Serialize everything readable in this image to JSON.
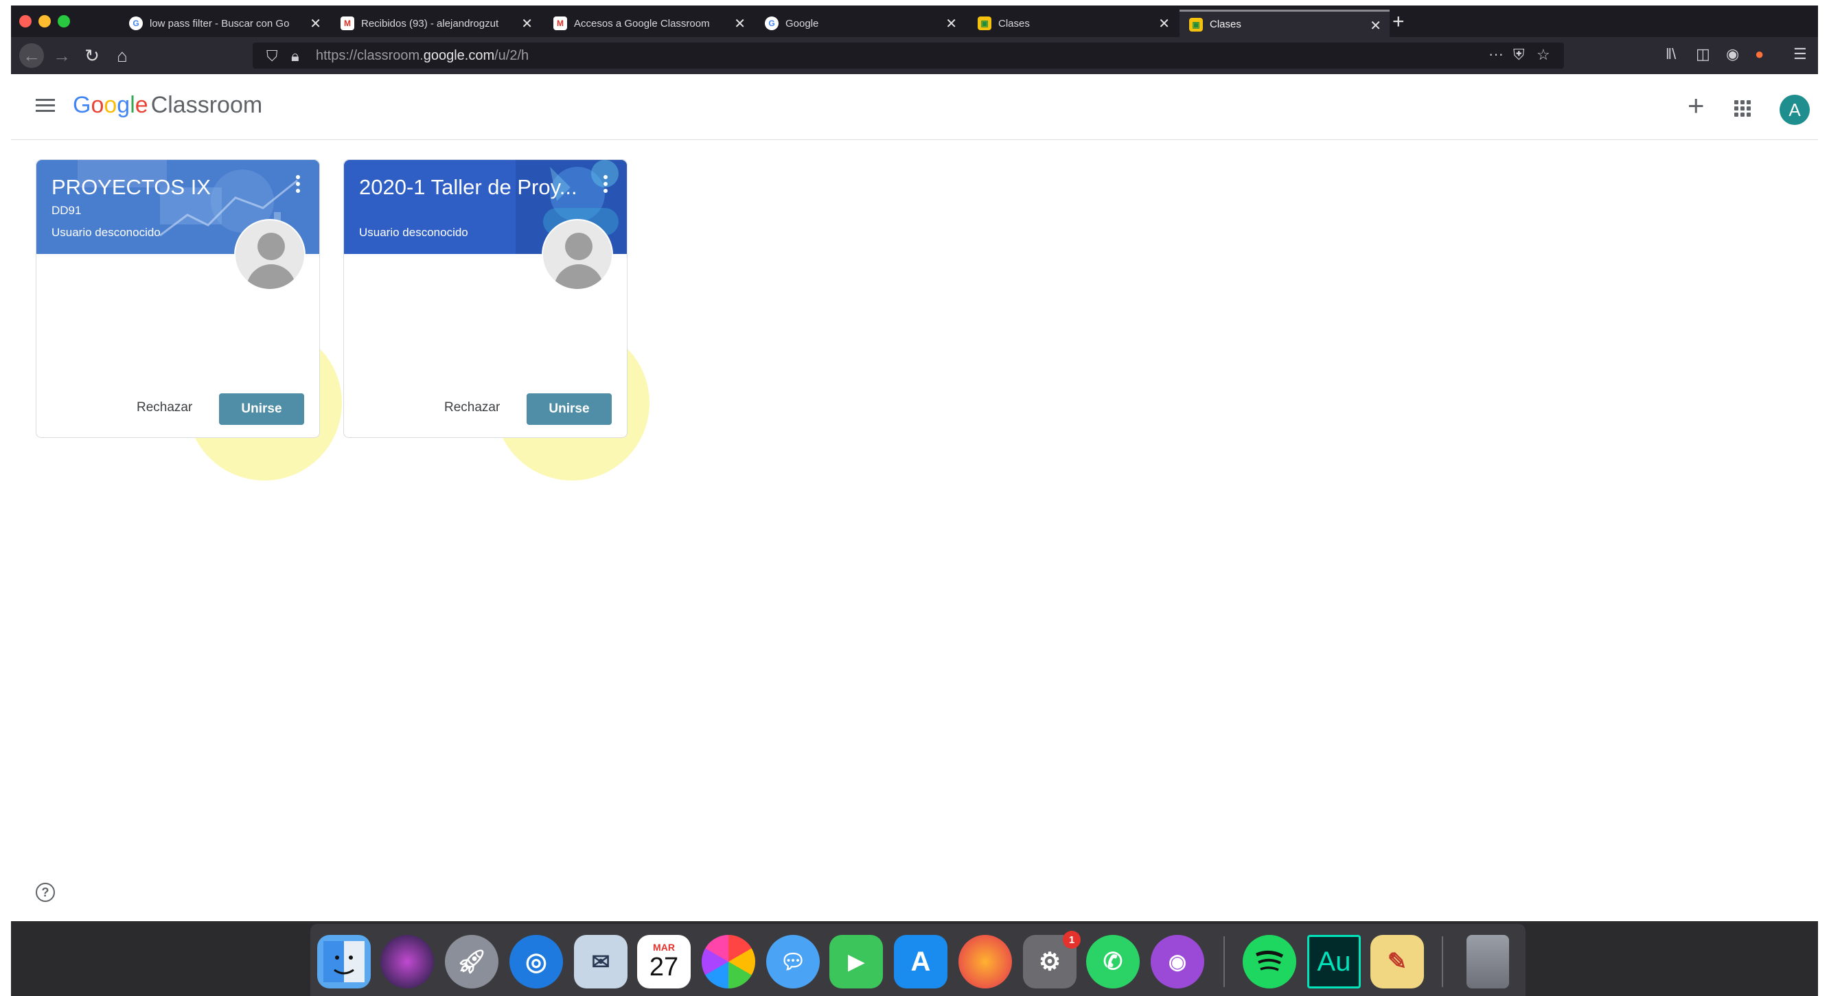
{
  "browser": {
    "tabs": [
      {
        "title": "low pass filter - Buscar con Go",
        "icon": "google-icon"
      },
      {
        "title": "Recibidos (93) - alejandrogzut",
        "icon": "gmail-icon"
      },
      {
        "title": "Accesos a Google Classroom",
        "icon": "gmail-icon"
      },
      {
        "title": "Google",
        "icon": "google-icon"
      },
      {
        "title": "Clases",
        "icon": "classroom-icon"
      },
      {
        "title": "Clases",
        "icon": "classroom-icon"
      }
    ],
    "active_tab_index": 5,
    "url_prefix": "https://classroom.",
    "url_domain": "google.com",
    "url_path": "/u/2/h"
  },
  "header": {
    "logo": {
      "g1": "G",
      "g2": "o",
      "g3": "o",
      "g4": "g",
      "g5": "l",
      "g6": "e"
    },
    "app_name": "Classroom",
    "account_initial": "A"
  },
  "cards": [
    {
      "title": "PROYECTOS IX",
      "section": "DD91",
      "owner": "Usuario desconocido",
      "reject_label": "Rechazar",
      "join_label": "Unirse",
      "banner_color": "#3f74c9"
    },
    {
      "title": "2020-1 Taller de Proy...",
      "section": "",
      "owner": "Usuario desconocido",
      "reject_label": "Rechazar",
      "join_label": "Unirse",
      "banner_color": "#2f5fc4"
    }
  ],
  "help": {
    "label": "?"
  },
  "dock": {
    "calendar_month": "MAR",
    "calendar_day": "27",
    "system_prefs_badge": "1",
    "audition_label": "Au"
  },
  "colors": {
    "join_button": "#4f8ea6",
    "highlight": "#faf596",
    "browser_dark": "#1c1b22"
  }
}
